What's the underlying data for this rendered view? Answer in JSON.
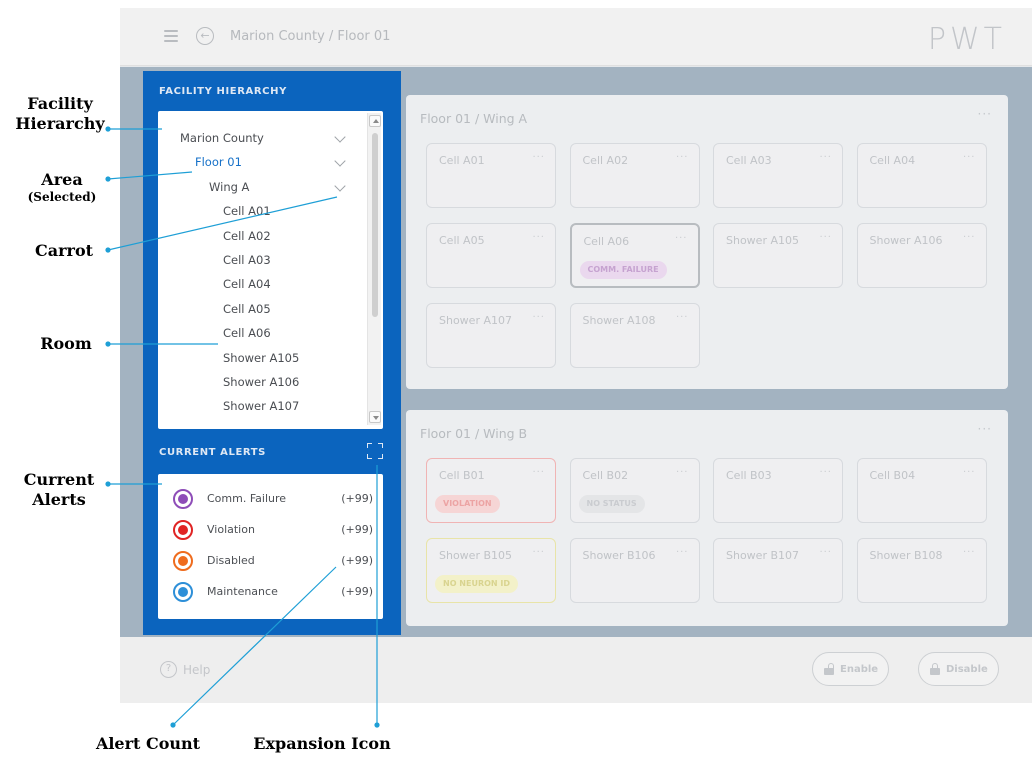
{
  "header": {
    "breadcrumb": "Marion County / Floor 01",
    "logo": "PWT"
  },
  "sidebar": {
    "hierarchy_title": "FACILITY HIERARCHY",
    "tree": [
      {
        "label": "Marion County",
        "chevron": true
      },
      {
        "label": "Floor 01",
        "chevron": true,
        "selected": true
      },
      {
        "label": "Wing A",
        "chevron": true
      },
      {
        "label": "Cell A01"
      },
      {
        "label": "Cell A02"
      },
      {
        "label": "Cell A03"
      },
      {
        "label": "Cell A04"
      },
      {
        "label": "Cell A05"
      },
      {
        "label": "Cell A06"
      },
      {
        "label": "Shower A105"
      },
      {
        "label": "Shower A106"
      },
      {
        "label": "Shower A107"
      }
    ],
    "alerts_title": "CURRENT ALERTS",
    "alerts": [
      {
        "label": "Comm. Failure",
        "count": "(+99)",
        "color": "#8e4db8",
        "icon": "warning-icon"
      },
      {
        "label": "Violation",
        "count": "(+99)",
        "color": "#e02424",
        "icon": "bell-icon"
      },
      {
        "label": "Disabled",
        "count": "(+99)",
        "color": "#ef6c1e",
        "icon": "lock-icon"
      },
      {
        "label": "Maintenance",
        "count": "(+99)",
        "color": "#2d8fd8",
        "icon": "wrench-icon"
      }
    ]
  },
  "wings": [
    {
      "title": "Floor 01 / Wing A",
      "cells": [
        {
          "name": "Cell A01"
        },
        {
          "name": "Cell A02"
        },
        {
          "name": "Cell A03"
        },
        {
          "name": "Cell A04"
        },
        {
          "name": "Cell A05"
        },
        {
          "name": "Cell A06",
          "badge": "COMM. FAILURE",
          "badge_style": "purple",
          "selected": true
        },
        {
          "name": "Shower A105"
        },
        {
          "name": "Shower A106"
        },
        {
          "name": "Shower A107"
        },
        {
          "name": "Shower A108"
        }
      ]
    },
    {
      "title": "Floor 01 / Wing B",
      "cells": [
        {
          "name": "Cell B01",
          "badge": "VIOLATION",
          "badge_style": "red",
          "border": "red"
        },
        {
          "name": "Cell B02",
          "badge": "NO STATUS",
          "badge_style": "gray"
        },
        {
          "name": "Cell B03"
        },
        {
          "name": "Cell B04"
        },
        {
          "name": "Shower B105",
          "badge": "NO NEURON ID",
          "badge_style": "yellow",
          "border": "yel"
        },
        {
          "name": "Shower B106"
        },
        {
          "name": "Shower B107"
        },
        {
          "name": "Shower B108"
        }
      ]
    }
  ],
  "footer": {
    "help_label": "Help",
    "enable_label": "Enable",
    "disable_label": "Disable"
  },
  "annotations": {
    "facility_hierarchy": "Facility Hierarchy",
    "area": "Area",
    "area_sub": "(Selected)",
    "carrot": "Carrot",
    "room": "Room",
    "current_alerts": "Current Alerts",
    "alert_count": "Alert Count",
    "expansion_icon": "Expansion Icon"
  },
  "colors": {
    "panel_blue": "#0b64be",
    "leader_line": "#1e9fd6",
    "selected_tree_item": "#1570c8"
  }
}
